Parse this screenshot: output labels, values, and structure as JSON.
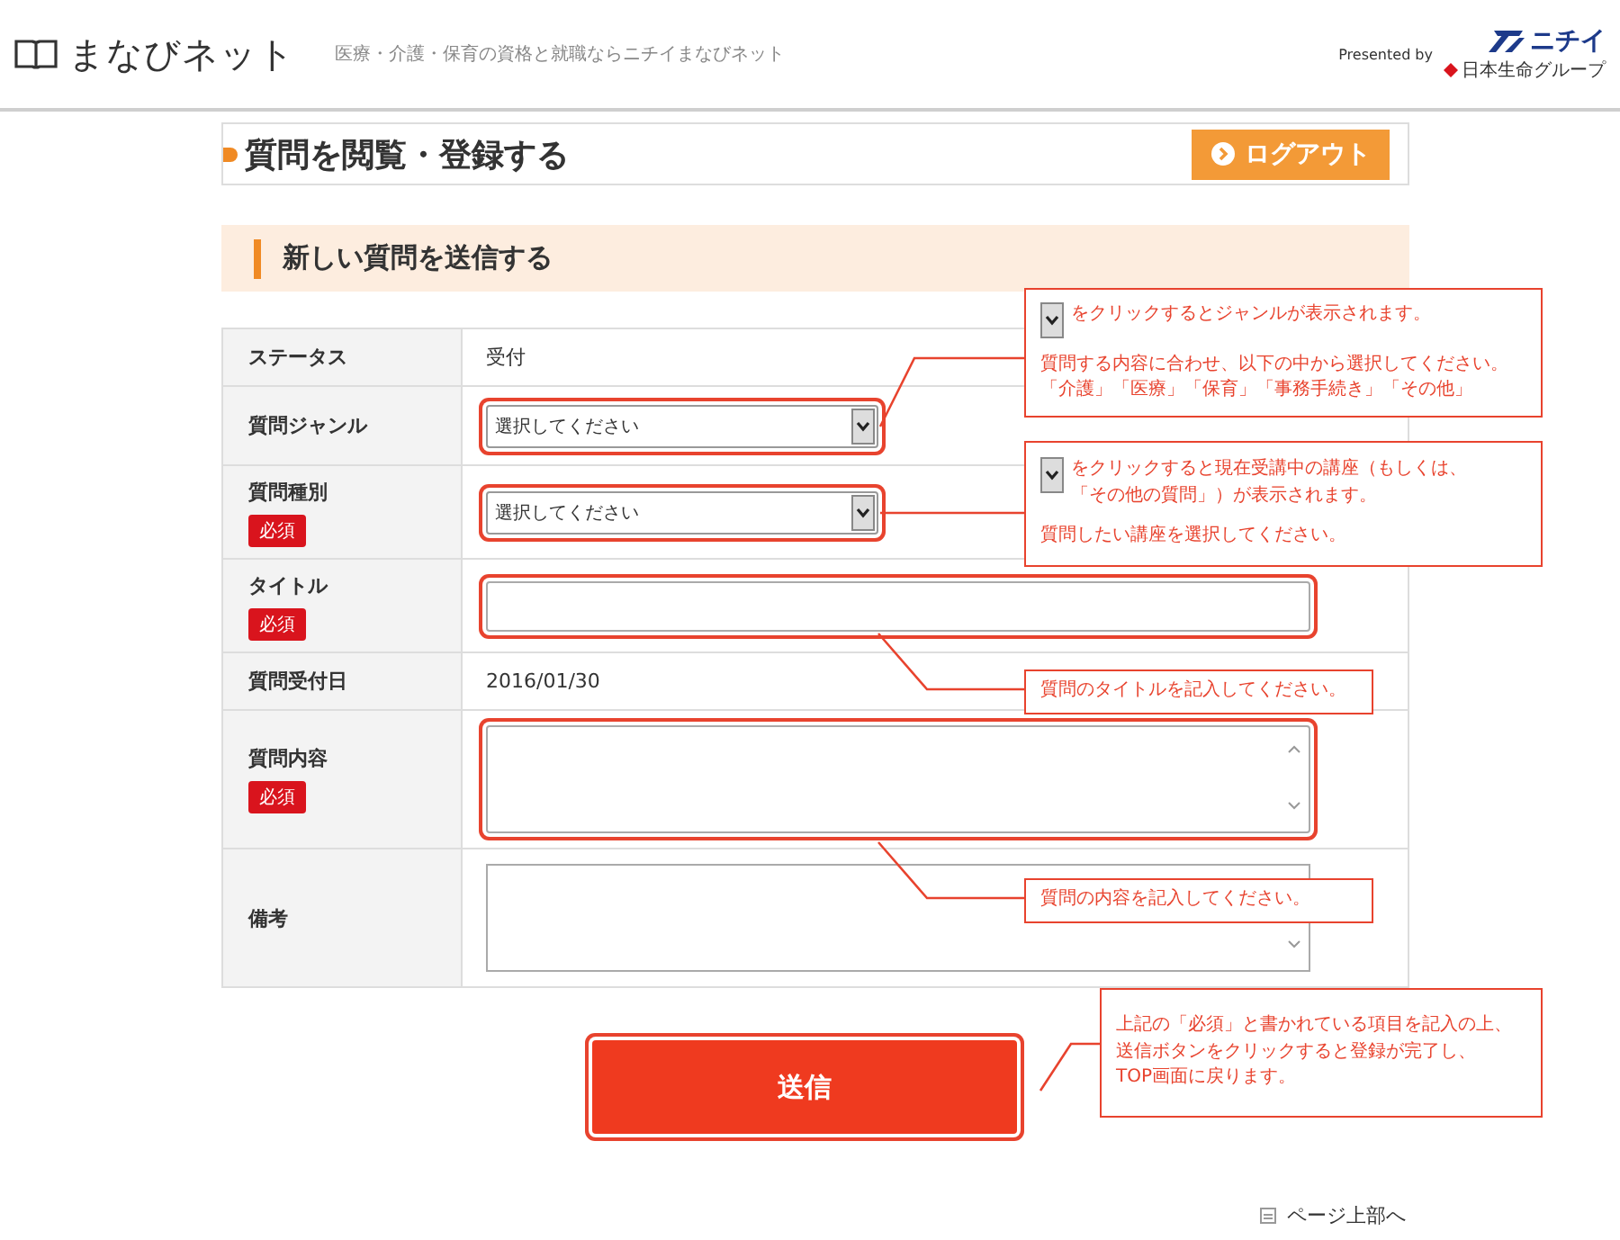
{
  "header": {
    "logo": "まなびネット",
    "tagline": "医療・介護・保育の資格と就職ならニチイまなびネット",
    "presented_by": "Presented by",
    "brand": "ニチイ",
    "brand_group": "日本生命グループ"
  },
  "page_title": "質問を閲覧・登録する",
  "logout_button": "ログアウト",
  "section_title": "新しい質問を送信する",
  "rows": [
    {
      "label": "ステータス",
      "kind": "text",
      "value": "受付"
    },
    {
      "label": "質問ジャンル",
      "kind": "select",
      "value": "選択してください",
      "highlighted": true
    },
    {
      "label": "質問種別",
      "kind": "select",
      "value": "選択してください",
      "badge": "必須",
      "highlighted": true
    },
    {
      "label": "タイトル",
      "kind": "input",
      "badge": "必須",
      "highlighted": true
    },
    {
      "label": "質問受付日",
      "kind": "text",
      "value": "2016/01/30"
    },
    {
      "label": "質問内容",
      "kind": "textarea",
      "badge": "必須",
      "highlighted": true
    },
    {
      "label": "備考",
      "kind": "textarea",
      "highlighted": false
    }
  ],
  "submit_button": {
    "label": "送信",
    "highlighted": true
  },
  "page_top_link": "ページ上部へ",
  "callouts": [
    {
      "dropdown_icon": true,
      "paragraphs": [
        [
          "をクリックするとジャンルが表示されます。"
        ],
        [
          "質問する内容に合わせ、以下の中から選択してください。",
          "「介護」「医療」「保育」「事務手続き」「その他」"
        ]
      ]
    },
    {
      "dropdown_icon": true,
      "paragraphs": [
        [
          "をクリックすると現在受講中の講座（もしくは、",
          "「その他の質問」）が表示されます。"
        ],
        [
          "質問したい講座を選択してください。"
        ]
      ]
    },
    {
      "dropdown_icon": false,
      "paragraphs": [
        [
          "質問のタイトルを記入してください。"
        ]
      ]
    },
    {
      "dropdown_icon": false,
      "paragraphs": [
        [
          "質問の内容を記入してください。"
        ]
      ]
    },
    {
      "dropdown_icon": false,
      "paragraphs": [
        [
          "上記の「必須」と書かれている項目を記入の上、",
          "送信ボタンをクリックすると登録が完了し、",
          "TOP画面に戻ります。"
        ]
      ]
    }
  ]
}
